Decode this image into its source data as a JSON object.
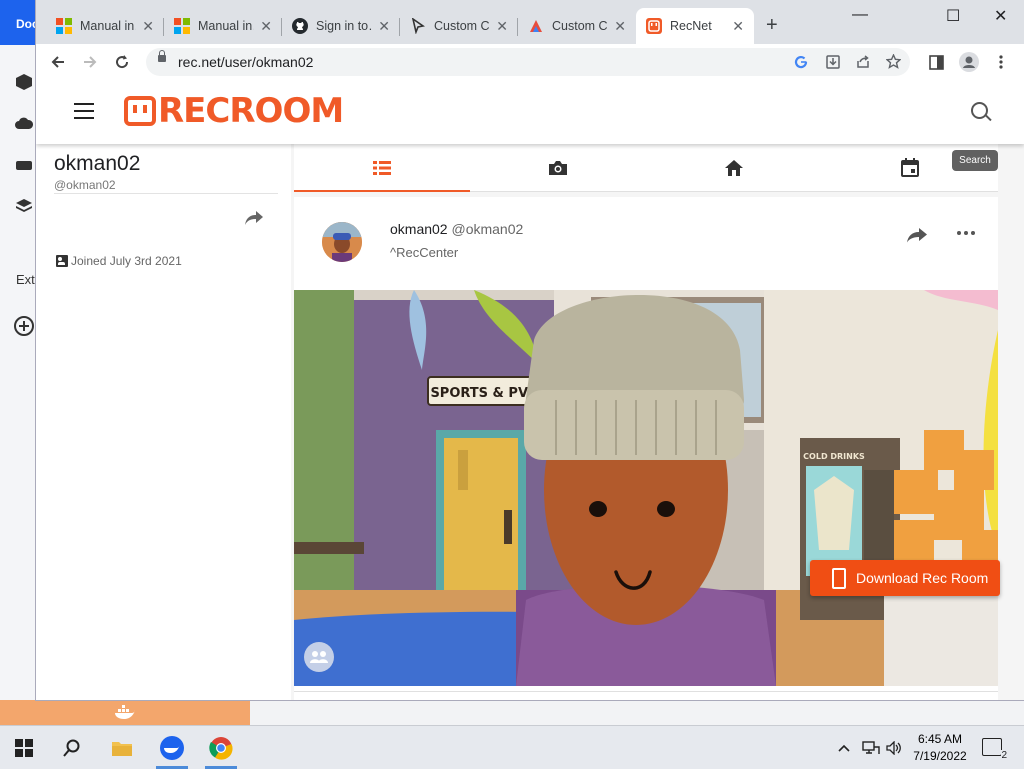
{
  "browser": {
    "tabs": [
      {
        "title": "Manual in…",
        "icon": "microsoft-icon",
        "close": "✕"
      },
      {
        "title": "Manual in…",
        "icon": "microsoft-icon",
        "close": "✕"
      },
      {
        "title": "Sign in to…",
        "icon": "github-icon",
        "close": "✕"
      },
      {
        "title": "Custom C…",
        "icon": "cursor-icon",
        "close": "✕"
      },
      {
        "title": "Custom C…",
        "icon": "chrome-extension-icon",
        "close": "✕"
      },
      {
        "title": "RecNet",
        "icon": "recroom-icon",
        "close": "✕",
        "active": true
      }
    ],
    "new_tab": "+",
    "window_controls": {
      "minimize": "—",
      "maximize": "☐",
      "close": "✕"
    },
    "url": "rec.net/user/okman02"
  },
  "background_app": {
    "top_text": "Doc",
    "ext_label": "Ext"
  },
  "site": {
    "logo_text": "RECROOM",
    "search_tooltip": "Search"
  },
  "profile": {
    "display_name": "okman02",
    "handle": "@okman02",
    "joined": "Joined July 3rd 2021"
  },
  "post": {
    "author_name": "okman02",
    "author_handle": "@okman02",
    "room": "^RecCenter",
    "photo_sign": "SPORTS & PVP",
    "vending_label": "COLD DRINKS"
  },
  "download_button": "Download Rec Room",
  "taskbar": {
    "time": "6:45 AM",
    "date": "7/19/2022",
    "notification_count": "2"
  },
  "colors": {
    "brand": "#f05a28",
    "chrome_tabstrip": "#dee1e6",
    "download_button": "#f04e14"
  }
}
